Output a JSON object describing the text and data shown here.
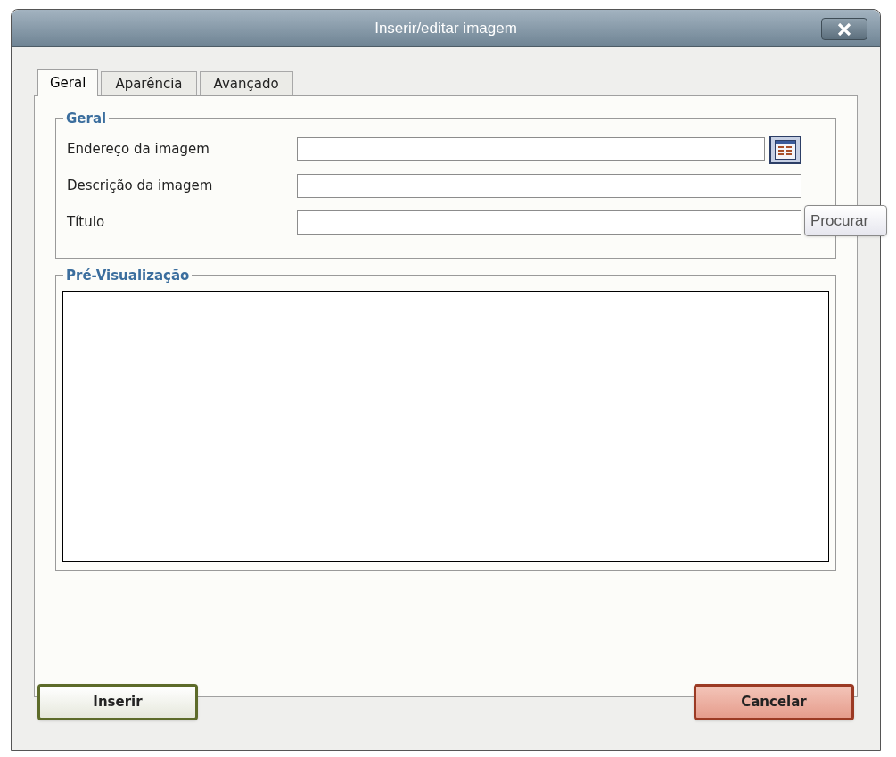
{
  "window": {
    "title": "Inserir/editar imagem"
  },
  "tabs": [
    {
      "label": "Geral",
      "selected": true
    },
    {
      "label": "Aparência",
      "selected": false
    },
    {
      "label": "Avançado",
      "selected": false
    }
  ],
  "general": {
    "legend": "Geral",
    "fields": [
      {
        "label": "Endereço da imagem",
        "browse": true
      },
      {
        "label": "Descrição da imagem",
        "browse": false
      },
      {
        "label": "Título",
        "browse": false
      }
    ]
  },
  "tooltip": "Procurar",
  "preview": {
    "legend": "Pré-Visualização"
  },
  "buttons": [
    {
      "label": "Inserir",
      "kind": "primary"
    },
    {
      "label": "Cancelar",
      "kind": "cancel"
    }
  ]
}
